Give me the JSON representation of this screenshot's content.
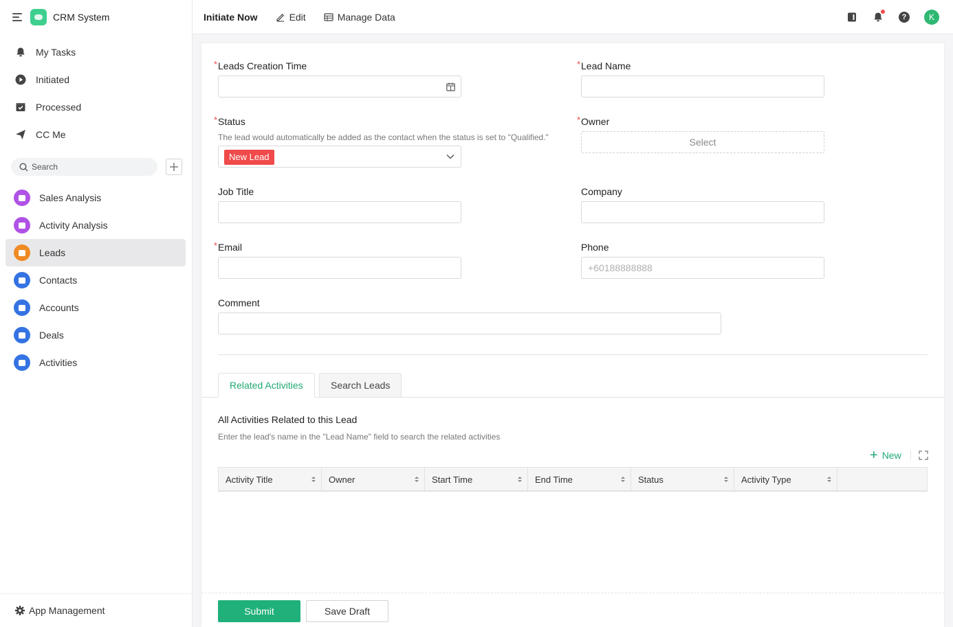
{
  "app": {
    "title": "CRM System"
  },
  "sidebar": {
    "nav": [
      {
        "label": "My Tasks",
        "icon": "bell-icon"
      },
      {
        "label": "Initiated",
        "icon": "play-icon"
      },
      {
        "label": "Processed",
        "icon": "check-box-icon"
      },
      {
        "label": "CC Me",
        "icon": "send-icon"
      }
    ],
    "search_label": "Search",
    "apps": [
      {
        "label": "Sales Analysis",
        "color": "#b052e6"
      },
      {
        "label": "Activity Analysis",
        "color": "#b052e6"
      },
      {
        "label": "Leads",
        "color": "#f08a24",
        "active": true
      },
      {
        "label": "Contacts",
        "color": "#3573e3"
      },
      {
        "label": "Accounts",
        "color": "#3573e3"
      },
      {
        "label": "Deals",
        "color": "#3573e3"
      },
      {
        "label": "Activities",
        "color": "#3573e3"
      }
    ],
    "footer_label": "App Management"
  },
  "topbar": {
    "initiate_label": "Initiate Now",
    "edit_label": "Edit",
    "manage_label": "Manage Data",
    "avatar_initial": "K"
  },
  "form": {
    "leads_creation_time": {
      "label": "Leads Creation Time",
      "required_mark": "*"
    },
    "lead_name": {
      "label": "Lead Name",
      "required_mark": "*"
    },
    "status": {
      "label": "Status",
      "required_mark": "*",
      "hint": "The lead would automatically be added as the contact when the status is set to \"Qualified.\"",
      "value": "New Lead"
    },
    "owner": {
      "label": "Owner",
      "required_mark": "*",
      "placeholder": "Select"
    },
    "job_title": {
      "label": "Job Title"
    },
    "company": {
      "label": "Company"
    },
    "email": {
      "label": "Email",
      "required_mark": "*"
    },
    "phone": {
      "label": "Phone",
      "placeholder": "+60188888888"
    },
    "comment": {
      "label": "Comment"
    }
  },
  "tabs": [
    {
      "label": "Related Activities",
      "active": true
    },
    {
      "label": "Search Leads",
      "active": false
    }
  ],
  "related": {
    "title": "All Activities Related to this Lead",
    "hint": "Enter the lead's name in the \"Lead Name\" field to search the related activities",
    "new_label": "New",
    "columns": [
      "Activity Title",
      "Owner",
      "Start Time",
      "End Time",
      "Status",
      "Activity Type"
    ]
  },
  "actions": {
    "submit_label": "Submit",
    "draft_label": "Save Draft"
  }
}
